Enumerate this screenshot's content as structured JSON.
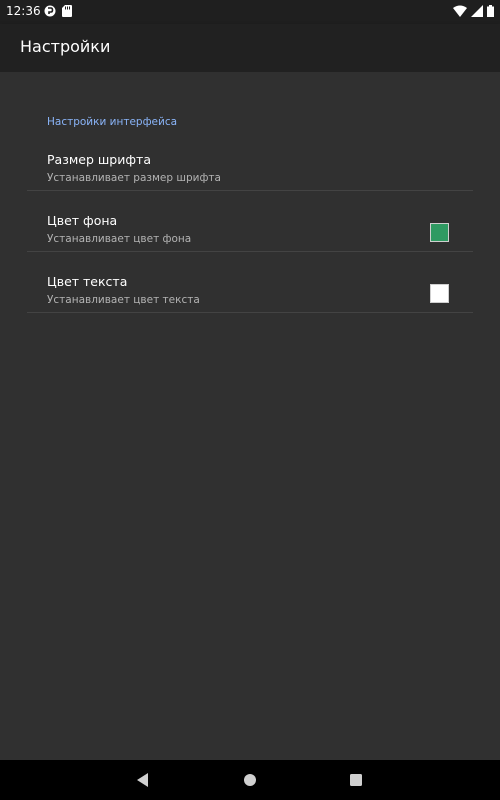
{
  "status_bar": {
    "time": "12:36",
    "left_icons": [
      "sync-icon",
      "sd-card-icon"
    ],
    "right_icons": [
      "wifi-icon",
      "signal-icon",
      "battery-icon"
    ]
  },
  "app_bar": {
    "title": "Настройки"
  },
  "settings": {
    "category": "Настройки интерфейса",
    "category_color": "#8ab4f8",
    "items": [
      {
        "title": "Размер шрифта",
        "summary": "Устанавливает размер шрифта"
      },
      {
        "title": "Цвет фона",
        "summary": "Устанавливает цвет фона",
        "swatch_color": "#2f9a62"
      },
      {
        "title": "Цвет текста",
        "summary": "Устанавливает цвет текста",
        "swatch_color": "#ffffff"
      }
    ]
  },
  "nav_bar": {
    "buttons": [
      "back-icon",
      "home-icon",
      "recents-icon"
    ]
  }
}
